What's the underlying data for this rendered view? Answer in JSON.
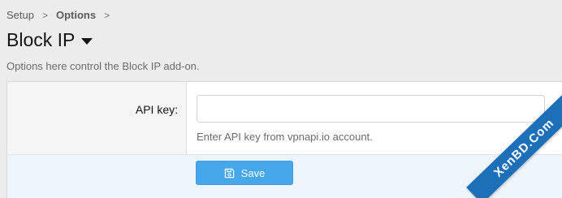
{
  "breadcrumb": {
    "items": [
      "Setup",
      "Options"
    ],
    "separator": ">"
  },
  "page": {
    "title": "Block IP",
    "description": "Options here control the Block IP add-on."
  },
  "form": {
    "api_key": {
      "label": "API key:",
      "value": "",
      "hint": "Enter API key from vpnapi.io account."
    },
    "save_label": "Save"
  },
  "watermark": {
    "text": "XenBD.Com"
  },
  "colors": {
    "accent": "#47a7eb",
    "footer_bg": "#eef5fc",
    "watermark": "#1d6fb8"
  },
  "icons": {
    "title_menu": "caret-down-icon",
    "save": "save-icon"
  }
}
